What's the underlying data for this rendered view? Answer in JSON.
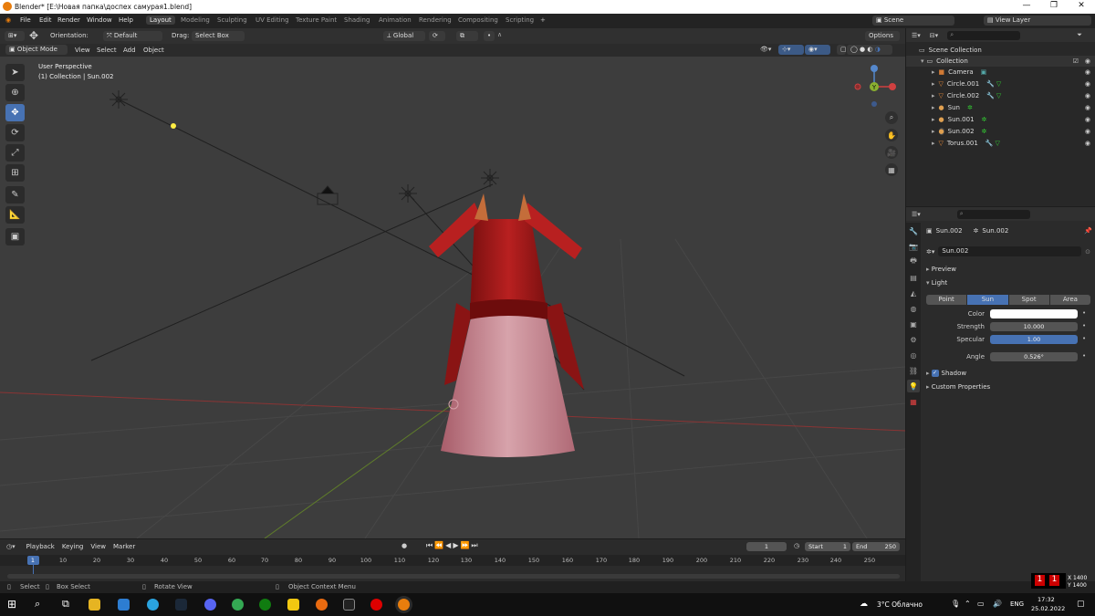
{
  "window": {
    "title": "Blender* [E:\\Новая папка\\доспех самурая1.blend]"
  },
  "menu": [
    "File",
    "Edit",
    "Render",
    "Window",
    "Help"
  ],
  "workspaces": [
    "Layout",
    "Modeling",
    "Sculpting",
    "UV Editing",
    "Texture Paint",
    "Shading",
    "Animation",
    "Rendering",
    "Compositing",
    "Scripting"
  ],
  "top_right": {
    "scene": "Scene",
    "view_layer": "View Layer"
  },
  "vp_header": {
    "orientation_label": "Orientation:",
    "orientation_value": "Default",
    "drag_label": "Drag:",
    "drag_value": "Select Box",
    "transform_orientation": "Global",
    "options": "Options"
  },
  "tool_header": {
    "mode": "Object Mode",
    "menus": [
      "View",
      "Select",
      "Add",
      "Object"
    ]
  },
  "viewport": {
    "perspective": "User Perspective",
    "collection": "(1) Collection | Sun.002"
  },
  "gizmo": {
    "y": "Y"
  },
  "outliner": {
    "root": "Scene Collection",
    "collection": "Collection",
    "items": [
      {
        "name": "Camera",
        "icon": "camera-icon",
        "color": "#d07a35"
      },
      {
        "name": "Circle.001",
        "icon": "mesh-icon",
        "color": "#e88a3a"
      },
      {
        "name": "Circle.002",
        "icon": "mesh-icon",
        "color": "#e88a3a"
      },
      {
        "name": "Sun",
        "icon": "light-icon",
        "color": "#e0a050"
      },
      {
        "name": "Sun.001",
        "icon": "light-icon",
        "color": "#e0a050"
      },
      {
        "name": "Sun.002",
        "icon": "light-icon",
        "color": "#e0a050"
      },
      {
        "name": "Torus.001",
        "icon": "mesh-icon",
        "color": "#e88a3a"
      }
    ]
  },
  "properties": {
    "object_name": "Sun.002",
    "data_name": "Sun.002",
    "datablock": "Sun.002",
    "preview": "Preview",
    "light": "Light",
    "light_types": [
      "Point",
      "Sun",
      "Spot",
      "Area"
    ],
    "active_type": "Sun",
    "color_label": "Color",
    "strength_label": "Strength",
    "strength": "10.000",
    "specular_label": "Specular",
    "specular": "1.00",
    "angle_label": "Angle",
    "angle": "0.526°",
    "shadow": "Shadow",
    "custom_props": "Custom Properties"
  },
  "timeline": {
    "menus": [
      "Playback",
      "Keying",
      "View",
      "Marker"
    ],
    "current_frame": "1",
    "start_label": "Start",
    "start": "1",
    "end_label": "End",
    "end": "250",
    "ticks": [
      "1",
      "10",
      "20",
      "30",
      "40",
      "50",
      "60",
      "70",
      "80",
      "90",
      "100",
      "110",
      "120",
      "130",
      "140",
      "150",
      "160",
      "170",
      "180",
      "190",
      "200",
      "210",
      "220",
      "230",
      "240",
      "250"
    ]
  },
  "status": {
    "select": "Select",
    "box_select": "Box Select",
    "rotate_view": "Rotate View",
    "context_menu": "Object Context Menu",
    "x": "X 1400",
    "y": "Y 1400"
  },
  "taskbar": {
    "weather": "3°C  Облачно",
    "lang": "ENG",
    "time": "17:32",
    "date": "25.02.2022"
  },
  "colors": {
    "accent": "#4772b3",
    "armor_red": "#a01b1b",
    "cone": "#c7868f"
  }
}
